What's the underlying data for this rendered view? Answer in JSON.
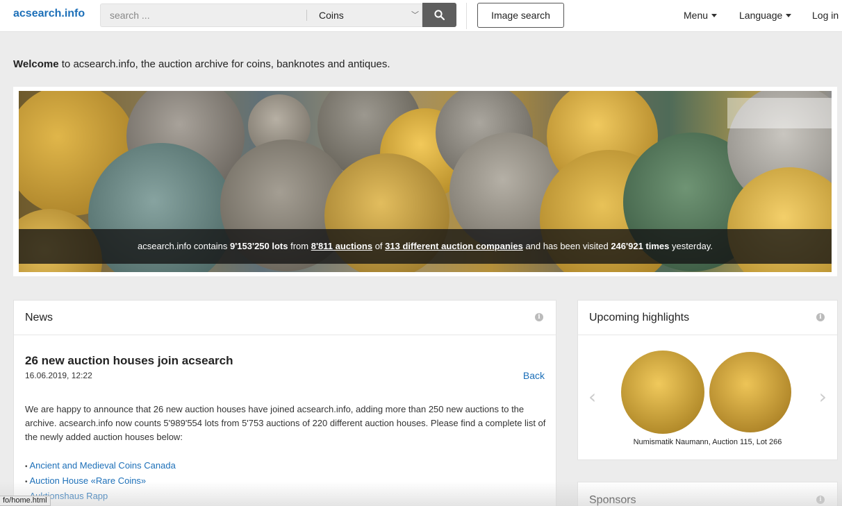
{
  "header": {
    "logo": "acsearch.info",
    "search_placeholder": "search ...",
    "category_selected": "Coins",
    "image_search_label": "Image search",
    "menu_label": "Menu",
    "language_label": "Language",
    "login_label": "Log in"
  },
  "welcome": {
    "bold": "Welcome",
    "rest": " to acsearch.info, the auction archive for coins, banknotes and antiques."
  },
  "banner": {
    "stats_prefix": "acsearch.info contains ",
    "lots": "9'153'250 lots",
    "from_text": " from ",
    "auctions": "8'811 auctions",
    "of_text": " of ",
    "companies": "313 different auction companies",
    "visited_text": " and has been visited ",
    "visits": "246'921 times",
    "suffix": " yesterday."
  },
  "news": {
    "panel_title": "News",
    "headline": "26 new auction houses join acsearch",
    "date": "16.06.2019, 12:22",
    "back_label": "Back",
    "body": "We are happy to announce that 26 new auction houses have joined acsearch.info, adding more than 250 new auctions to the archive. acsearch.info now counts 5'989'554 lots from 5'753 auctions of 220 different auction houses. Please find a complete list of the newly added auction houses below:",
    "houses": [
      "Ancient and Medieval Coins Canada",
      "Auction House «Rare Coins»",
      "Auktionshaus Rapp"
    ]
  },
  "highlights": {
    "panel_title": "Upcoming highlights",
    "caption": "Numismatik Naumann, Auction 115, Lot 266"
  },
  "sponsors": {
    "panel_title": "Sponsors"
  },
  "status": {
    "url": "fo/home.html"
  },
  "icons": {
    "search": "search-icon",
    "info": "info-icon",
    "chevron_left": "chevron-left-icon",
    "chevron_right": "chevron-right-icon"
  },
  "colors": {
    "brand": "#1c6fb8",
    "search_button": "#5e5e5e"
  }
}
